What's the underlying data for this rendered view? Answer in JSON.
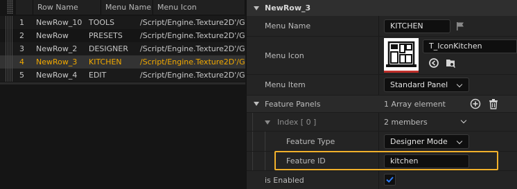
{
  "table": {
    "headers": [
      "",
      "Row Name",
      "Menu Name",
      "Menu Icon"
    ],
    "rows": [
      {
        "index": "1",
        "row_name": "NewRow_10",
        "menu_name": "TOOLS",
        "menu_icon": "/Script/Engine.Texture2D'/G"
      },
      {
        "index": "2",
        "row_name": "NewRow",
        "menu_name": "PRESETS",
        "menu_icon": "/Script/Engine.Texture2D'/G"
      },
      {
        "index": "3",
        "row_name": "NewRow_2",
        "menu_name": "DESIGNER",
        "menu_icon": "/Script/Engine.Texture2D'/G"
      },
      {
        "index": "4",
        "row_name": "NewRow_3",
        "menu_name": "KITCHEN",
        "menu_icon": "/Script/Engine.Texture2D'/G"
      },
      {
        "index": "5",
        "row_name": "NewRow_4",
        "menu_name": "EDIT",
        "menu_icon": "/Script/Engine.Texture2D'/G"
      }
    ],
    "selected_index": 3,
    "selected_color": "#f2a900"
  },
  "details": {
    "section_title": "NewRow_3",
    "menu_name": {
      "label": "Menu Name",
      "value": "KITCHEN"
    },
    "menu_icon": {
      "label": "Menu Icon",
      "asset_name": "T_IconKitchen"
    },
    "menu_item": {
      "label": "Menu Item",
      "value": "Standard Panel"
    },
    "feature_panels": {
      "label": "Feature Panels",
      "summary": "1 Array element"
    },
    "index_entry": {
      "label": "Index [ 0 ]",
      "summary": "2 members"
    },
    "feature_type": {
      "label": "Feature Type",
      "value": "Designer Mode"
    },
    "feature_id": {
      "label": "Feature ID",
      "value": "kitchen"
    },
    "is_enabled": {
      "label": "is Enabled",
      "checked": true
    },
    "highlight_color": "#f2b12b",
    "accent_color": "#2d7fff"
  },
  "icons": [
    "flag-icon",
    "browse-icon",
    "find-in-browser-icon",
    "add-element-icon",
    "delete-icon",
    "kitchen-thumbnail"
  ]
}
